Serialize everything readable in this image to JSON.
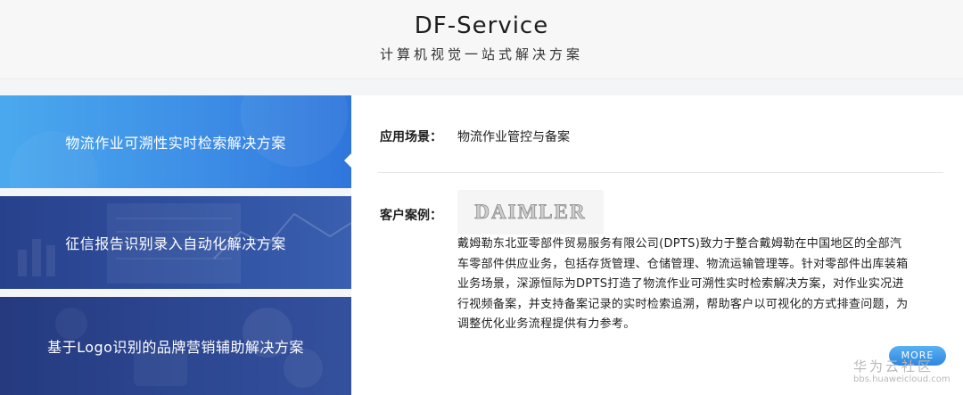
{
  "header": {
    "title": "DF-Service",
    "subtitle": "计算机视觉一站式解决方案"
  },
  "sidebar": {
    "items": [
      {
        "label": "物流作业可溯性实时检索解决方案",
        "active": true
      },
      {
        "label": "征信报告识别录入自动化解决方案",
        "active": false
      },
      {
        "label": "基于Logo识别的品牌营销辅助解决方案",
        "active": false
      }
    ]
  },
  "detail": {
    "scene_label": "应用场景：",
    "scene_value": "物流作业管控与备案",
    "case_label": "客户案例：",
    "logo_text": "DAIMLER",
    "case_lines": [
      "戴姆勒东北亚零部件贸易服务有限公司(DPTS)致力于整合戴姆勒在中国地区的全部汽",
      "车零部件供应业务，包括存货管理、仓储管理、物流运输管理等。针对零部件出库装箱",
      "业务场景，深源恒际为DPTS打造了物流作业可溯性实时检索解决方案，对作业实况进",
      "行视频备案，并支持备案记录的实时检索追溯，帮助客户以可视化的方式排查问题，为",
      "调整优化业务流程提供有力参考。"
    ],
    "more_label": "MORE"
  },
  "watermark": {
    "main": "华为云社区",
    "sub": "bbs.huaweicloud.com"
  },
  "colors": {
    "active_tab": "#3e8fe6",
    "inactive_tab": "#2c4690",
    "more_button": "#3b94e6"
  }
}
